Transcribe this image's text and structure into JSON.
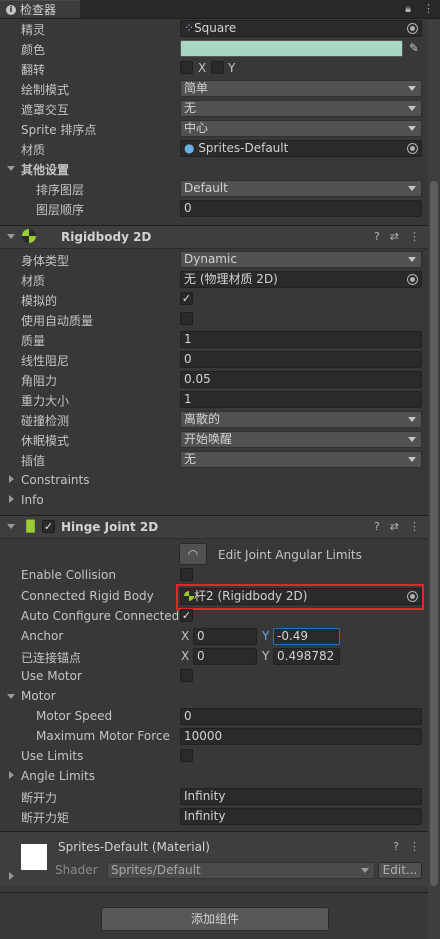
{
  "window": {
    "tab_title": "检查器"
  },
  "sprite_renderer": {
    "sprite_label": "精灵",
    "sprite_value": "Square",
    "color_label": "颜色",
    "color_value": "#a8d8c4",
    "flip_label": "翻转",
    "flip_x": "X",
    "flip_y": "Y",
    "draw_mode_label": "绘制模式",
    "draw_mode_value": "简单",
    "mask_label": "遮罩交互",
    "mask_value": "无",
    "sort_point_label": "Sprite 排序点",
    "sort_point_value": "中心",
    "material_label": "材质",
    "material_value": "Sprites-Default",
    "other_settings_label": "其他设置",
    "sorting_layer_label": "排序图层",
    "sorting_layer_value": "Default",
    "order_label": "图层顺序",
    "order_value": "0"
  },
  "rigidbody2d": {
    "title": "Rigidbody 2D",
    "body_type_label": "身体类型",
    "body_type_value": "Dynamic",
    "material_label": "材质",
    "material_value": "无 (物理材质 2D)",
    "simulated_label": "模拟的",
    "auto_mass_label": "使用自动质量",
    "mass_label": "质量",
    "mass_value": "1",
    "linear_drag_label": "线性阻尼",
    "linear_drag_value": "0",
    "angular_drag_label": "角阻力",
    "angular_drag_value": "0.05",
    "gravity_label": "重力大小",
    "gravity_value": "1",
    "collision_label": "碰撞检测",
    "collision_value": "离散的",
    "sleep_label": "休眠模式",
    "sleep_value": "开始唤醒",
    "interp_label": "插值",
    "interp_value": "无",
    "constraints_label": "Constraints",
    "info_label": "Info"
  },
  "hinge_joint": {
    "title": "Hinge Joint 2D",
    "edit_limits_label": "Edit Joint Angular Limits",
    "enable_collision_label": "Enable Collision",
    "connected_body_label": "Connected Rigid Body",
    "connected_body_value": "杆2 (Rigidbody 2D)",
    "auto_config_label": "Auto Configure Connected",
    "anchor_label": "Anchor",
    "anchor_x": "0",
    "anchor_y": "-0.49",
    "conn_anchor_label": "已连接锚点",
    "conn_anchor_x": "0",
    "conn_anchor_y": "0.498782",
    "x_label": "X",
    "y_label": "Y",
    "use_motor_label": "Use Motor",
    "motor_label": "Motor",
    "motor_speed_label": "Motor Speed",
    "motor_speed_value": "0",
    "max_force_label": "Maximum Motor Force",
    "max_force_value": "10000",
    "use_limits_label": "Use Limits",
    "angle_limits_label": "Angle Limits",
    "break_force_label": "断开力",
    "break_force_value": "Infinity",
    "break_torque_label": "断开力矩",
    "break_torque_value": "Infinity"
  },
  "material_panel": {
    "title": "Sprites-Default (Material)",
    "shader_label": "Shader",
    "shader_value": "Sprites/Default",
    "edit_label": "Edit..."
  },
  "add_component_label": "添加组件",
  "colors": {
    "highlight": "#e2262a",
    "accent_field": "#2a6fb8"
  }
}
